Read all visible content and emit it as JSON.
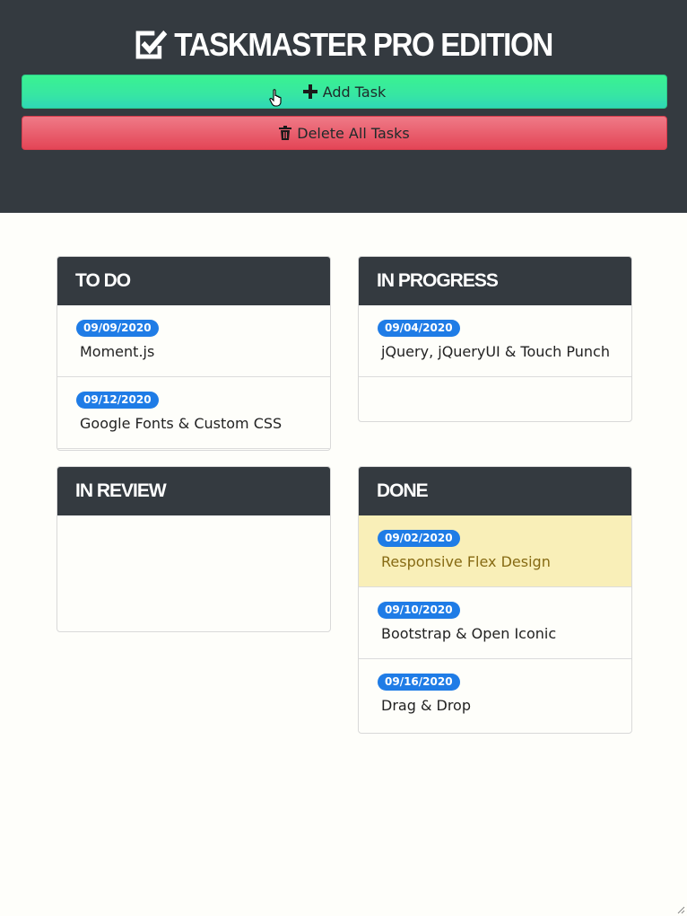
{
  "header": {
    "title": "Taskmaster Pro Edition",
    "add_label": "Add Task",
    "delete_label": "Delete All Tasks"
  },
  "columns": {
    "todo": {
      "title": "To Do",
      "items": [
        {
          "date": "09/09/2020",
          "text": "Moment.js"
        },
        {
          "date": "09/12/2020",
          "text": "Google Fonts & Custom CSS"
        }
      ]
    },
    "inprogress": {
      "title": "In Progress",
      "items": [
        {
          "date": "09/04/2020",
          "text": "jQuery, jQueryUI & Touch Punch"
        }
      ]
    },
    "inreview": {
      "title": "In Review",
      "items": []
    },
    "done": {
      "title": "Done",
      "items": [
        {
          "date": "09/02/2020",
          "text": "Responsive Flex Design"
        },
        {
          "date": "09/10/2020",
          "text": "Bootstrap & Open Iconic"
        },
        {
          "date": "09/16/2020",
          "text": "Drag & Drop"
        }
      ]
    }
  },
  "colors": {
    "header_bg": "#343a40",
    "add_button": "#37e6a3",
    "delete_button": "#e34556",
    "badge": "#1f7ce6",
    "highlight_item": "#f9efb8"
  },
  "icons": {
    "title": "check-square-icon",
    "add": "plus-icon",
    "delete": "trash-icon",
    "cursor": "hand-pointer-icon"
  }
}
